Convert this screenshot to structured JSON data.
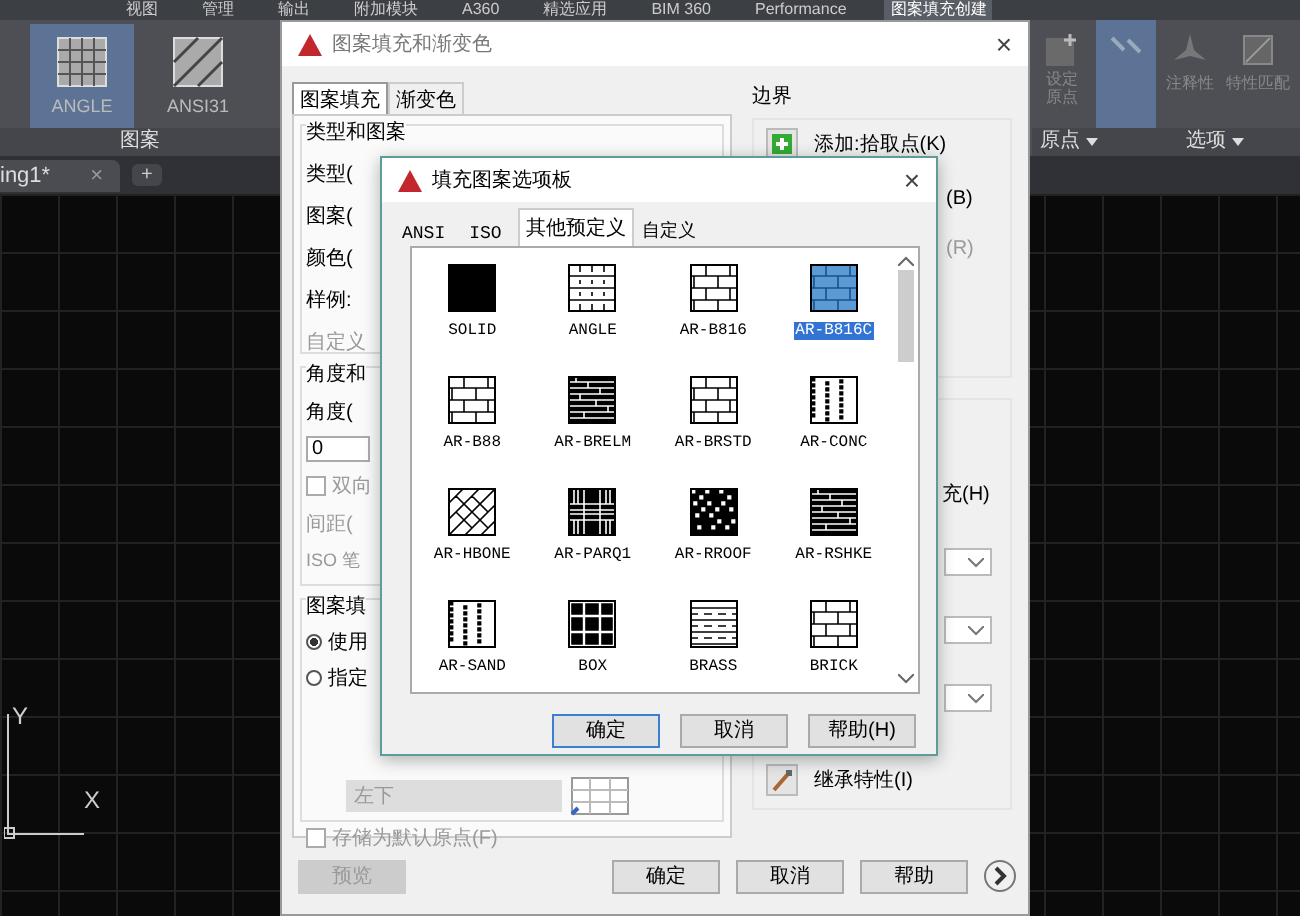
{
  "menu_tabs": [
    {
      "label": "视图",
      "selected": false
    },
    {
      "label": "管理",
      "selected": false
    },
    {
      "label": "输出",
      "selected": false
    },
    {
      "label": "附加模块",
      "selected": false
    },
    {
      "label": "A360",
      "selected": false
    },
    {
      "label": "精选应用",
      "selected": false
    },
    {
      "label": "BIM 360",
      "selected": false
    },
    {
      "label": "Performance",
      "selected": false
    },
    {
      "label": "图案填充创建",
      "selected": true
    }
  ],
  "ribbon": {
    "patterns": [
      {
        "label": "ANGLE",
        "selected": true
      },
      {
        "label": "ANSI31",
        "selected": false
      }
    ],
    "pattern_panel": "图案",
    "set_origin": "设定原点",
    "origin_panel": "原点",
    "associative": {
      "selected": true
    },
    "annotative": "注释性",
    "match": "特性匹配",
    "options_panel": "选项"
  },
  "doc_tabs": {
    "tabs": [
      {
        "label": "ing1*",
        "selected": true
      }
    ],
    "close": "×",
    "new_tab": "+"
  },
  "drawing": {
    "y_label": "Y",
    "x_label": "X"
  },
  "hatch_dialog": {
    "title": "图案填充和渐变色",
    "close": "×",
    "tabs": [
      {
        "label": "图案填充",
        "selected": true
      },
      {
        "label": "渐变色",
        "selected": false
      }
    ],
    "type_group": {
      "title": "类型和图案",
      "labels": [
        {
          "text": "类型(",
          "disabled": false
        },
        {
          "text": "图案(",
          "disabled": false
        },
        {
          "text": "颜色(",
          "disabled": false
        },
        {
          "text": "样例:",
          "disabled": false
        },
        {
          "text": "自定义",
          "disabled": true
        }
      ]
    },
    "angle_group": {
      "title": "角度和",
      "angle_label": "角度(",
      "angle_value": "0",
      "double": {
        "label": "双向",
        "checked": false
      },
      "spacing_label": "间距(",
      "iso_label": "ISO 笔"
    },
    "origin_group": {
      "title": "图案填",
      "options": [
        {
          "label": "使用",
          "selected": true
        },
        {
          "label": "指定",
          "selected": false
        }
      ],
      "position_value": "左下",
      "store_default": {
        "label": "存储为默认原点(F)",
        "checked": false
      }
    },
    "preview_button": "预览",
    "boundary_group": {
      "title": "边界",
      "add_pick": "添加:拾取点(K)",
      "add_select_fragment": "(B)",
      "remove_fragment": "(R)"
    },
    "options_group": {
      "fill_fragment": "充(H)",
      "inherit": "继承特性(I)"
    },
    "buttons": [
      "确定",
      "取消",
      "帮助"
    ]
  },
  "palette_dialog": {
    "title": "填充图案选项板",
    "close": "×",
    "tabs": [
      {
        "label": "ANSI",
        "selected": false
      },
      {
        "label": "ISO",
        "selected": false
      },
      {
        "label": "其他预定义",
        "selected": true
      },
      {
        "label": "自定义",
        "selected": false
      }
    ],
    "patterns": [
      {
        "label": "SOLID",
        "kind": "solid",
        "selected": false
      },
      {
        "label": "ANGLE",
        "kind": "angle",
        "selected": false
      },
      {
        "label": "AR-B816",
        "kind": "brick",
        "selected": false
      },
      {
        "label": "AR-B816C",
        "kind": "brick",
        "selected": true
      },
      {
        "label": "AR-B88",
        "kind": "brick",
        "selected": false
      },
      {
        "label": "AR-BRELM",
        "kind": "dense",
        "selected": false
      },
      {
        "label": "AR-BRSTD",
        "kind": "brick",
        "selected": false
      },
      {
        "label": "AR-CONC",
        "kind": "speckle",
        "selected": false
      },
      {
        "label": "AR-HBONE",
        "kind": "herringbone",
        "selected": false
      },
      {
        "label": "AR-PARQ1",
        "kind": "parquet",
        "selected": false
      },
      {
        "label": "AR-RROOF",
        "kind": "starry",
        "selected": false
      },
      {
        "label": "AR-RSHKE",
        "kind": "dense",
        "selected": false
      },
      {
        "label": "AR-SAND",
        "kind": "speckle",
        "selected": false
      },
      {
        "label": "BOX",
        "kind": "box",
        "selected": false
      },
      {
        "label": "BRASS",
        "kind": "lines",
        "selected": false
      },
      {
        "label": "BRICK",
        "kind": "brick",
        "selected": false
      }
    ],
    "buttons": [
      {
        "label": "确定",
        "default": true
      },
      {
        "label": "取消",
        "default": false
      },
      {
        "label": "帮助(H)",
        "default": false
      }
    ]
  }
}
